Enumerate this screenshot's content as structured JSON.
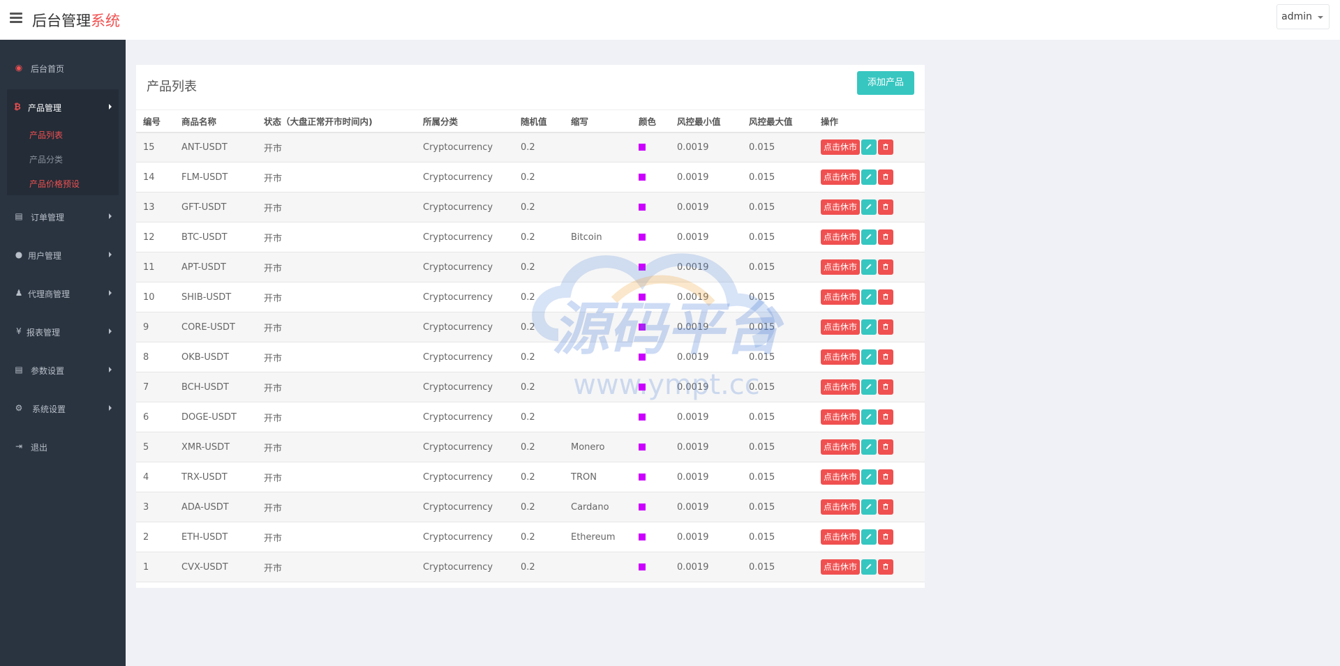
{
  "header": {
    "brand_main": "后台管理",
    "brand_accent": "系统",
    "user": "admin"
  },
  "sidebar": {
    "home": "后台首页",
    "product_group": {
      "label": "产品管理",
      "items": [
        "产品列表",
        "产品分类",
        "产品价格预设"
      ]
    },
    "items": [
      "订单管理",
      "用户管理",
      "代理商管理",
      "报表管理",
      "参数设置",
      "系统设置"
    ],
    "logout": "退出"
  },
  "panel": {
    "title": "产品列表",
    "add_button": "添加产品"
  },
  "table": {
    "headers": [
      "编号",
      "商品名称",
      "状态（大盘正常开市时间内)",
      "所属分类",
      "随机值",
      "缩写",
      "颜色",
      "风控最小值",
      "风控最大值",
      "操作"
    ],
    "swatch_color": "#cc00ff",
    "rest_label": "点击休市",
    "rows": [
      {
        "id": "15",
        "name": "ANT-USDT",
        "status": "开市",
        "category": "Cryptocurrency",
        "random": "0.2",
        "abbr": "",
        "min": "0.0019",
        "max": "0.015"
      },
      {
        "id": "14",
        "name": "FLM-USDT",
        "status": "开市",
        "category": "Cryptocurrency",
        "random": "0.2",
        "abbr": "",
        "min": "0.0019",
        "max": "0.015"
      },
      {
        "id": "13",
        "name": "GFT-USDT",
        "status": "开市",
        "category": "Cryptocurrency",
        "random": "0.2",
        "abbr": "",
        "min": "0.0019",
        "max": "0.015"
      },
      {
        "id": "12",
        "name": "BTC-USDT",
        "status": "开市",
        "category": "Cryptocurrency",
        "random": "0.2",
        "abbr": "Bitcoin",
        "min": "0.0019",
        "max": "0.015"
      },
      {
        "id": "11",
        "name": "APT-USDT",
        "status": "开市",
        "category": "Cryptocurrency",
        "random": "0.2",
        "abbr": "",
        "min": "0.0019",
        "max": "0.015"
      },
      {
        "id": "10",
        "name": "SHIB-USDT",
        "status": "开市",
        "category": "Cryptocurrency",
        "random": "0.2",
        "abbr": "",
        "min": "0.0019",
        "max": "0.015"
      },
      {
        "id": "9",
        "name": "CORE-USDT",
        "status": "开市",
        "category": "Cryptocurrency",
        "random": "0.2",
        "abbr": "",
        "min": "0.0019",
        "max": "0.015"
      },
      {
        "id": "8",
        "name": "OKB-USDT",
        "status": "开市",
        "category": "Cryptocurrency",
        "random": "0.2",
        "abbr": "",
        "min": "0.0019",
        "max": "0.015"
      },
      {
        "id": "7",
        "name": "BCH-USDT",
        "status": "开市",
        "category": "Cryptocurrency",
        "random": "0.2",
        "abbr": "",
        "min": "0.0019",
        "max": "0.015"
      },
      {
        "id": "6",
        "name": "DOGE-USDT",
        "status": "开市",
        "category": "Cryptocurrency",
        "random": "0.2",
        "abbr": "",
        "min": "0.0019",
        "max": "0.015"
      },
      {
        "id": "5",
        "name": "XMR-USDT",
        "status": "开市",
        "category": "Cryptocurrency",
        "random": "0.2",
        "abbr": "Monero",
        "min": "0.0019",
        "max": "0.015"
      },
      {
        "id": "4",
        "name": "TRX-USDT",
        "status": "开市",
        "category": "Cryptocurrency",
        "random": "0.2",
        "abbr": "TRON",
        "min": "0.0019",
        "max": "0.015"
      },
      {
        "id": "3",
        "name": "ADA-USDT",
        "status": "开市",
        "category": "Cryptocurrency",
        "random": "0.2",
        "abbr": "Cardano",
        "min": "0.0019",
        "max": "0.015"
      },
      {
        "id": "2",
        "name": "ETH-USDT",
        "status": "开市",
        "category": "Cryptocurrency",
        "random": "0.2",
        "abbr": "Ethereum",
        "min": "0.0019",
        "max": "0.015"
      },
      {
        "id": "1",
        "name": "CVX-USDT",
        "status": "开市",
        "category": "Cryptocurrency",
        "random": "0.2",
        "abbr": "",
        "min": "0.0019",
        "max": "0.015"
      }
    ]
  },
  "watermark": {
    "text": "源码平台",
    "url": "www.ympt.cc"
  }
}
